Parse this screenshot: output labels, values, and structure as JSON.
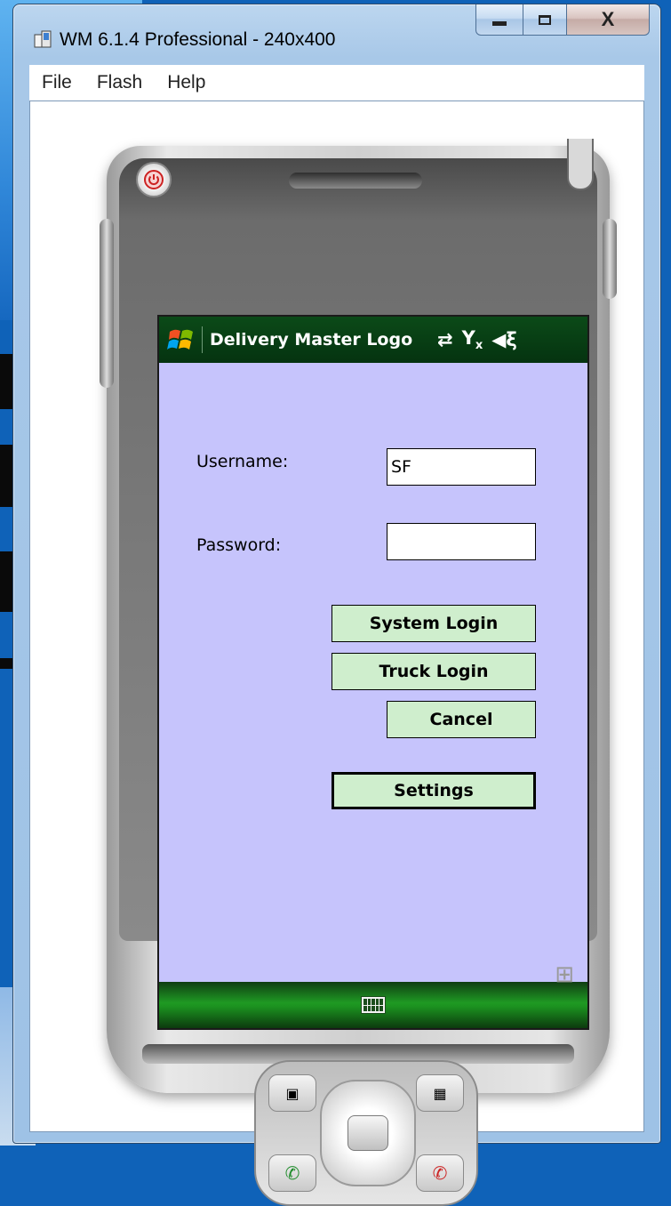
{
  "window": {
    "title": "WM 6.1.4 Professional - 240x400",
    "close_glyph": "X"
  },
  "menu": {
    "items": [
      "File",
      "Flash",
      "Help"
    ]
  },
  "device": {
    "status_bar": {
      "app_title": "Delivery Master Logo",
      "icons": [
        "connectivity-icon",
        "signal-off-icon",
        "speaker-icon"
      ]
    },
    "form": {
      "username_label": "Username:",
      "username_value": "SF",
      "password_label": "Password:",
      "password_value": ""
    },
    "buttons": {
      "system_login": "System Login",
      "truck_login": "Truck Login",
      "cancel": "Cancel",
      "settings": "Settings"
    },
    "colors": {
      "screen_bg": "#c6c4fc",
      "button_bg": "#cfeecd",
      "status_bar_bg": "#053310",
      "softkey_bar_green": "#1f9a23"
    }
  }
}
